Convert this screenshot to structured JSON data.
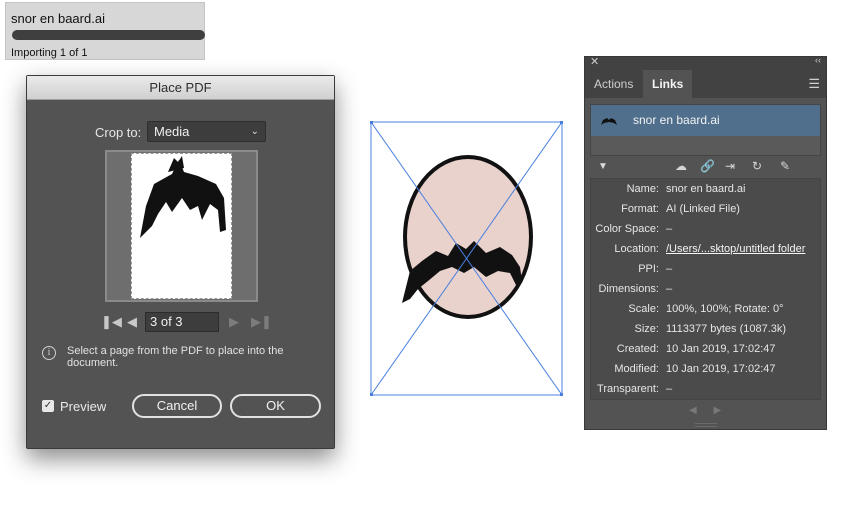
{
  "import": {
    "filename": "snor en baard.ai",
    "status": "Importing 1 of 1",
    "progress": 1.0
  },
  "dialog": {
    "title": "Place PDF",
    "crop_label": "Crop to:",
    "crop_value": "Media",
    "page_field": "3 of 3",
    "info_text": "Select a page from the PDF to place into the document.",
    "preview_label": "Preview",
    "preview_checked": true,
    "cancel_label": "Cancel",
    "ok_label": "OK"
  },
  "panel": {
    "tab_actions": "Actions",
    "tab_links": "Links",
    "link_name": "snor en baard.ai",
    "details": [
      {
        "key": "Name:",
        "value": "snor en baard.ai"
      },
      {
        "key": "Format:",
        "value": "AI (Linked File)"
      },
      {
        "key": "Color Space:",
        "value": "–"
      },
      {
        "key": "Location:",
        "value": "/Users/...sktop/untitled folder"
      },
      {
        "key": "PPI:",
        "value": "–"
      },
      {
        "key": "Dimensions:",
        "value": "–"
      },
      {
        "key": "Scale:",
        "value": "100%, 100%; Rotate: 0°"
      },
      {
        "key": "Size:",
        "value": "1113377 bytes (1087.3k)"
      },
      {
        "key": "Created:",
        "value": "10 Jan 2019, 17:02:47"
      },
      {
        "key": "Modified:",
        "value": "10 Jan 2019, 17:02:47"
      },
      {
        "key": "Transparent:",
        "value": "–"
      }
    ]
  },
  "colors": {
    "panel_bg": "#535353",
    "selected_row": "#4f6f8c",
    "selection_blue": "#4a7fe0",
    "face_fill": "#e9d2cc"
  },
  "icons": {
    "close": "close-icon",
    "collapse": "collapse-panel-icon",
    "panel_menu": "hamburger-menu-icon",
    "info": "info-icon"
  }
}
